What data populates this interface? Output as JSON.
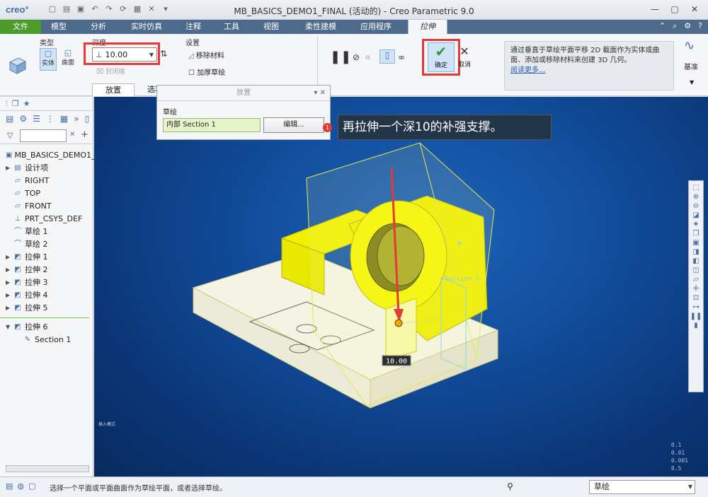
{
  "app": {
    "logo": "creo°",
    "window_title": "MB_BASICS_DEMO1_FINAL (活动的) - Creo Parametric 9.0"
  },
  "menu": {
    "tabs": [
      "文件",
      "模型",
      "分析",
      "实时仿真",
      "注释",
      "工具",
      "视图",
      "柔性建模",
      "应用程序",
      "拉伸"
    ],
    "active": "拉伸"
  },
  "ribbon": {
    "type_label": "类型",
    "solid_label": "实体",
    "surface_label": "曲面",
    "depth_label": "深度",
    "depth_value": "10.00",
    "capped_ends_label": "封闭端",
    "settings_label": "设置",
    "remove_material_label": "移除材料",
    "thicken_sketch_label": "加厚草绘",
    "ok_label": "确定",
    "cancel_label": "取消",
    "info_text": "通过垂直于草绘平面平移 2D 截面作为实体或曲面、添加或移除材料来创建 3D 几何。",
    "info_more": "阅读更多...",
    "datum_label": "基准",
    "subtab_placement": "放置",
    "subtab_options": "选项"
  },
  "placement_panel": {
    "title": "放置",
    "sketch_label": "草绘",
    "section_value": "内部 Section 1",
    "edit_button": "编辑..."
  },
  "annotation": {
    "number": "1",
    "text": "再拉伸一个深10的补强支撑。"
  },
  "model_tree": [
    {
      "label": "MB_BASICS_DEMO1_",
      "icon": "part-icon",
      "expand": ""
    },
    {
      "label": "设计项",
      "icon": "design-items-icon",
      "expand": "▶"
    },
    {
      "label": "RIGHT",
      "icon": "datum-plane-icon",
      "expand": ""
    },
    {
      "label": "TOP",
      "icon": "datum-plane-icon",
      "expand": ""
    },
    {
      "label": "FRONT",
      "icon": "datum-plane-icon",
      "expand": ""
    },
    {
      "label": "PRT_CSYS_DEF",
      "icon": "csys-icon",
      "expand": ""
    },
    {
      "label": "草绘 1",
      "icon": "sketch-icon",
      "expand": ""
    },
    {
      "label": "草绘 2",
      "icon": "sketch-icon",
      "expand": ""
    },
    {
      "label": "拉伸 1",
      "icon": "extrude-icon",
      "expand": "▶"
    },
    {
      "label": "拉伸 2",
      "icon": "extrude-icon",
      "expand": "▶"
    },
    {
      "label": "拉伸 3",
      "icon": "extrude-icon",
      "expand": "▶"
    },
    {
      "label": "拉伸 4",
      "icon": "extrude-icon",
      "expand": "▶"
    },
    {
      "label": "拉伸 5",
      "icon": "extrude-icon",
      "expand": "▶"
    },
    {
      "label": "拉伸 6",
      "icon": "extrude-icon",
      "expand": "▼"
    },
    {
      "label": "Section 1",
      "icon": "section-icon",
      "expand": ""
    }
  ],
  "viewport": {
    "dimension_label": "10.00",
    "section_label": "Section 1",
    "corner_text": "0.1\n0.01\n0.001\n0.5",
    "small_text": "插入模式"
  },
  "status": {
    "message": "选择一个平面或平面曲面作为草绘平面，或者选择草绘。",
    "filter_value": "草绘"
  },
  "colors": {
    "accent_red": "#e53935",
    "model_yellow": "#f0f000",
    "base_white": "#f4f3e4",
    "viewport_blue": "#114c9a"
  }
}
